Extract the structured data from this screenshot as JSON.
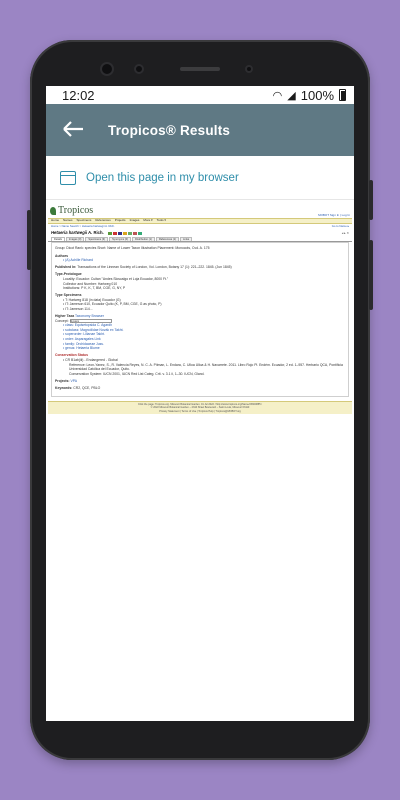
{
  "statusbar": {
    "time": "12:02",
    "battery": "100%",
    "wifi_icon": "wifi-icon",
    "signal_icon": "signal-icon"
  },
  "appbar": {
    "back_icon": "arrow-left-icon",
    "title": "Tropicos® Results"
  },
  "open_bar": {
    "icon": "browser-icon",
    "label": "Open this page in my browser"
  },
  "web": {
    "logo": "Tropicos",
    "signin": "MOBOT Sign In | Log In",
    "nav": [
      "Home",
      "Names",
      "Specimens",
      "References",
      "Projects",
      "Images",
      "More ▾",
      "Tools ▾"
    ],
    "breadcrumb": "Home > Name Search > Hetaeria hartwegii A. Rich.",
    "breadcrumb_right": "Go to Name ▸",
    "name_genus": "Hetaeria",
    "name_epithet": "hartwegii",
    "name_author": "A. Rich.",
    "tabs": [
      "Details",
      "Images (0)",
      "Specimens (3)",
      "Synonyms (0)",
      "Distribution (1)",
      "References (1)",
      "Links"
    ],
    "group_line": "Group: Dicot   Rank: species   Short: Name of Lower Taxon   Illustration Placement: Monocots, Cvd. A. 175",
    "authors_label": "Authors",
    "authors_value": "• (A) Achille Richard",
    "published_label": "Published In:",
    "published_value": "Transactions of the Linnean Society of London, Vol. London, Botany 17 (1): 221–222. 1845. (Jun 1845)",
    "type_protologue_label": "Type-Protologue",
    "type_protologue_lines": [
      "Locality: Ecuador: Cuitan \"Andes Sloscalgo et Loja Ecuador, 8000 Ft.\"",
      "Collector and Number: Hartweg 010",
      "Institutions: P K, K, T, BM, CGE, G, NY, P"
    ],
    "type_specimens_label": "Type Specimens",
    "type_specimens_lines": [
      "• T: Hartweg 818 (in data) Ecuador (G)",
      "• IT: Jameson 610, Ecuador Quito (K, P, BM, CGE, G as photo, P)",
      "• IT: Jameson 114..."
    ],
    "higher_taxa_label": "Higher Taxa",
    "higher_taxa_hint": "Taxonomy Browser",
    "concept_label": "Concept:",
    "concept_value": "System",
    "higher_taxa_lines": [
      "• class: Equisetopsida C. Agardh",
      "• subclass: Magnoliidae Novák ex Takht.",
      "• superorder: Lilianae Takht.",
      "• order: Asparagales Link",
      "• family: Orchidaceae Juss.",
      "• genus: Hetaeria Blume"
    ],
    "conservation_label": "Conservation Status",
    "conservation_lines": [
      "• CR B1ab(iii) - Endangered - Global",
      "Reference: Leon-Yanez, S., R. Valencia Reyes, N. C. A. Pitman, L. Endara, C. Ulloa Ulloa & H. Navarrete. 2011. Libro Rojo Pl. Endém. Ecuador, 2 ed. 1–957. Herbario QCA, Pontificia Universidad Católica del Ecuador, Quito.",
      "Conservation System: IUCN 2001, IUCN Red List Categ. Crit. v. 3.1 ii, 1–30. IUCN, Gland."
    ],
    "projects_label": "Projects:",
    "projects_value": "VPA",
    "keywords_label": "Keywords:",
    "keywords_value": "CR2, QCE, PBLO",
    "footer_lines": [
      "Click the page: Tropicos.org. Missouri Botanical Garden. 01 Jul 2022 <http://www.tropicos.org/Name/23600885>",
      "© 2022 Missouri Botanical Garden – 4344 Shaw Boulevard – Saint Louis, Missouri 63110",
      "Privacy Statement | Terms of Use | Tropicos Help | Tropicos@MOBOT.org"
    ]
  }
}
